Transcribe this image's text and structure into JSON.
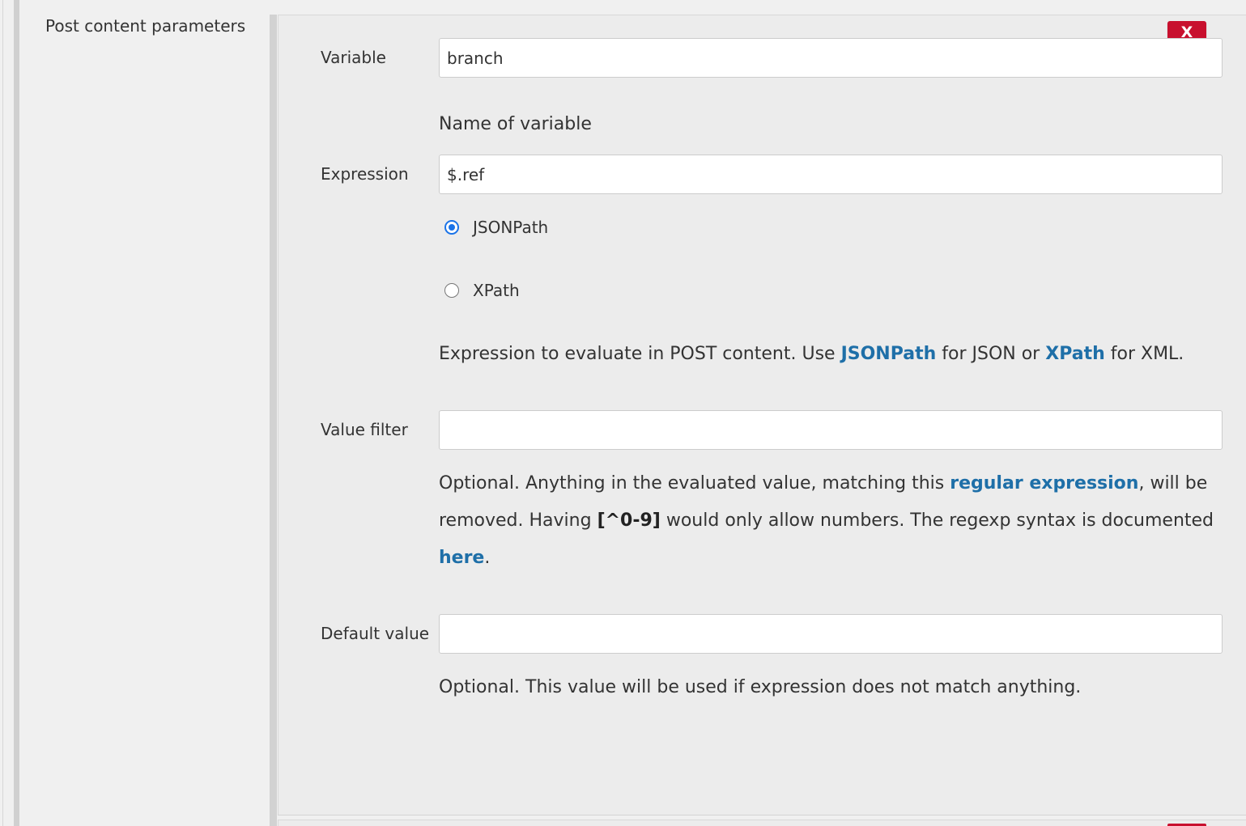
{
  "section": {
    "label": "Post content parameters"
  },
  "delete_button": {
    "label": "X"
  },
  "variable": {
    "label": "Variable",
    "value": "branch",
    "help": "Name of variable"
  },
  "expression": {
    "label": "Expression",
    "value": "$.ref",
    "options": [
      {
        "label": "JSONPath",
        "selected": true
      },
      {
        "label": "XPath",
        "selected": false
      }
    ],
    "help": {
      "prefix": "Expression to evaluate in POST content. Use ",
      "link1": "JSONPath",
      "middle": " for JSON or ",
      "link2": "XPath",
      "suffix": " for XML."
    }
  },
  "value_filter": {
    "label": "Value filter",
    "value": "",
    "help": {
      "p1": "Optional. Anything in the evaluated value, matching this ",
      "link1": "regular expression",
      "p2": ", will be removed. Having ",
      "code": "[^0-9]",
      "p3": " would only allow numbers. The regexp syntax is documented ",
      "link2": "here",
      "p4": "."
    }
  },
  "default_value": {
    "label": "Default value",
    "value": "",
    "help": "Optional. This value will be used if expression does not match anything."
  }
}
